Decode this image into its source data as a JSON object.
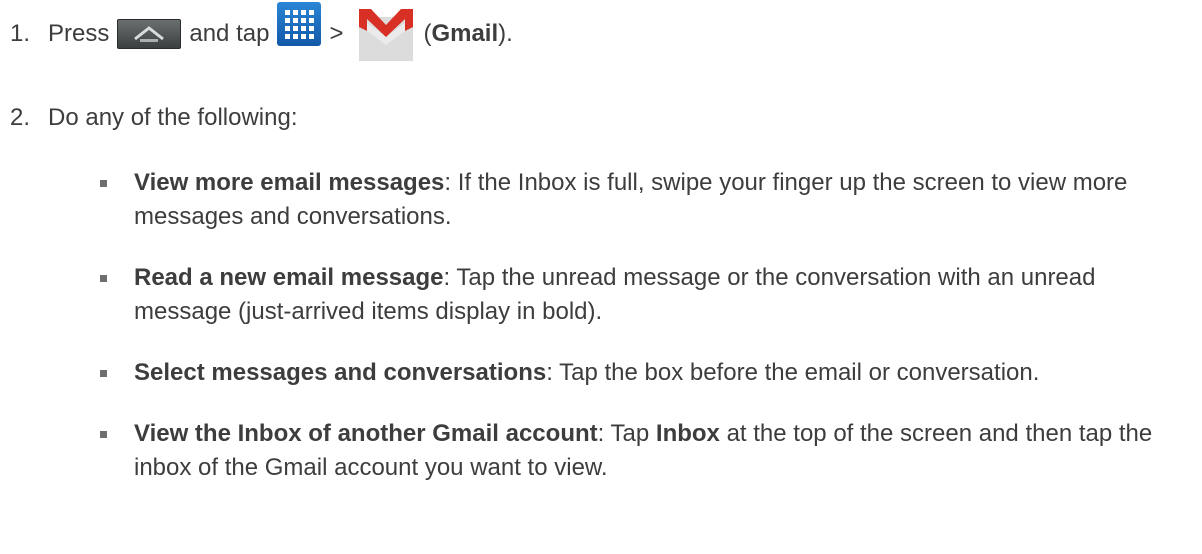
{
  "steps": [
    {
      "number": "1.",
      "parts": {
        "press": "Press",
        "and_tap": "and tap",
        "separator": ">",
        "open_paren": "(",
        "app_name": "Gmail",
        "close_paren": ")."
      },
      "icons": [
        "home-key-icon",
        "apps-grid-icon",
        "gmail-icon"
      ]
    },
    {
      "number": "2.",
      "text": "Do any of the following:"
    }
  ],
  "bullets": [
    {
      "bold": "View more email messages",
      "text": ": If the Inbox is full, swipe your finger up the screen to view more messages and conversations."
    },
    {
      "bold": "Read a new email message",
      "text": ": Tap the unread message or the conversation with an unread message (just-arrived items display in bold)."
    },
    {
      "bold": "Select messages and conversations",
      "text": ": Tap the box before the email or conversation."
    },
    {
      "bold": "View the Inbox of another Gmail account",
      "text_before": ": Tap ",
      "bold2": "Inbox",
      "text": " at the top of the screen and then tap the inbox of the Gmail account you want to view."
    }
  ],
  "colors": {
    "text": "#3d3d3d",
    "bullet": "#6e6e6e",
    "apps_icon": "#1e6fc2",
    "gmail_red": "#d93025"
  }
}
